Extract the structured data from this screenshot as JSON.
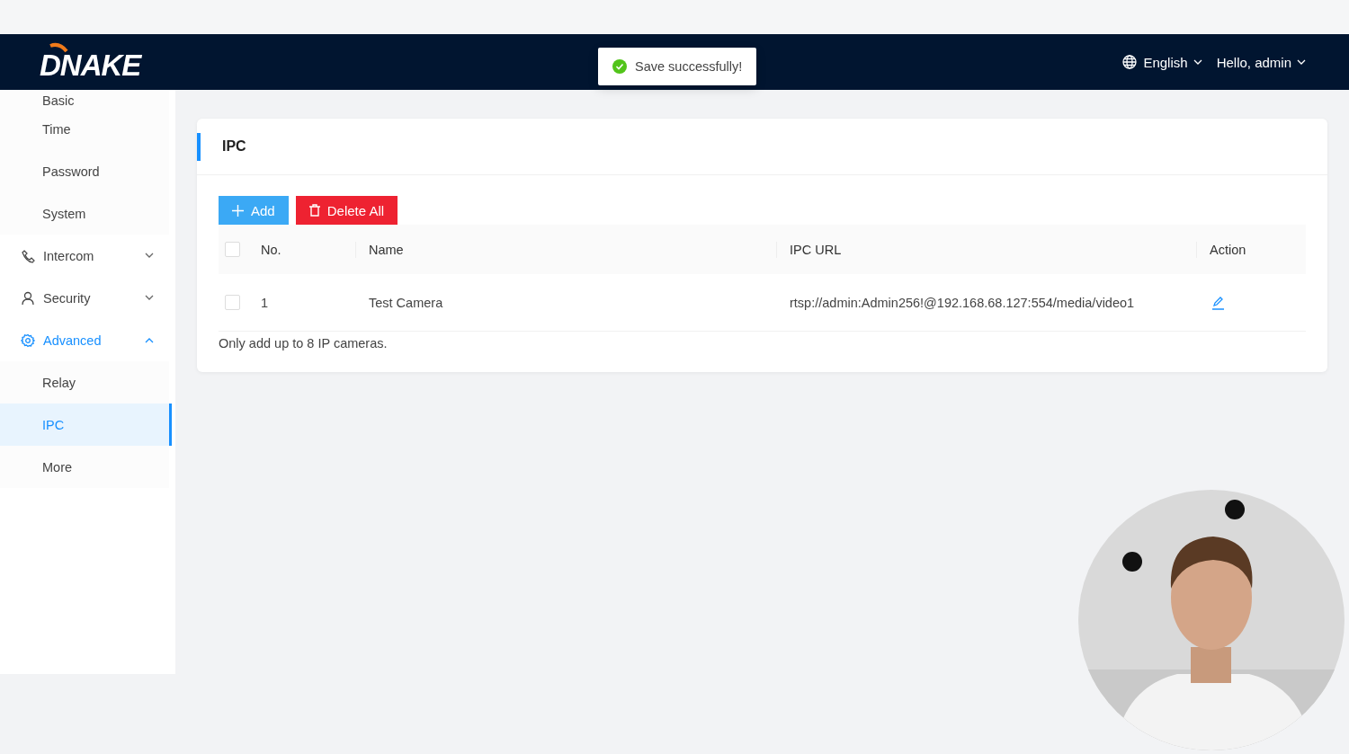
{
  "header": {
    "logo": "DNAKE",
    "language": "English",
    "user": "Hello, admin"
  },
  "toast": {
    "message": "Save successfully!"
  },
  "sidebar": {
    "items": [
      {
        "label": "Basic",
        "kind": "sub",
        "selected": false
      },
      {
        "label": "Time",
        "kind": "sub",
        "selected": false
      },
      {
        "label": "Password",
        "kind": "sub",
        "selected": false
      },
      {
        "label": "System",
        "kind": "sub",
        "selected": false
      },
      {
        "label": "Intercom",
        "kind": "group",
        "expanded": false
      },
      {
        "label": "Security",
        "kind": "group",
        "expanded": false
      },
      {
        "label": "Advanced",
        "kind": "group",
        "expanded": true,
        "children": [
          {
            "label": "Relay",
            "kind": "sub",
            "selected": false
          },
          {
            "label": "IPC",
            "kind": "sub",
            "selected": true
          },
          {
            "label": "More",
            "kind": "sub",
            "selected": false
          }
        ]
      }
    ]
  },
  "card": {
    "title": "IPC",
    "buttons": [
      {
        "label": "Add",
        "kind": "add"
      },
      {
        "label": "Delete All",
        "kind": "delete"
      }
    ],
    "table": {
      "select_all": {
        "checked": false
      },
      "columns": [
        "No.",
        "Name",
        "IPC URL",
        "Action"
      ],
      "rows": [
        {
          "checked": false,
          "cells": [
            "1",
            "Test Camera",
            "rtsp://admin:Admin256!@192.168.68.127:554/media/video1"
          ]
        }
      ]
    },
    "note": "Only add up to 8 IP cameras."
  }
}
